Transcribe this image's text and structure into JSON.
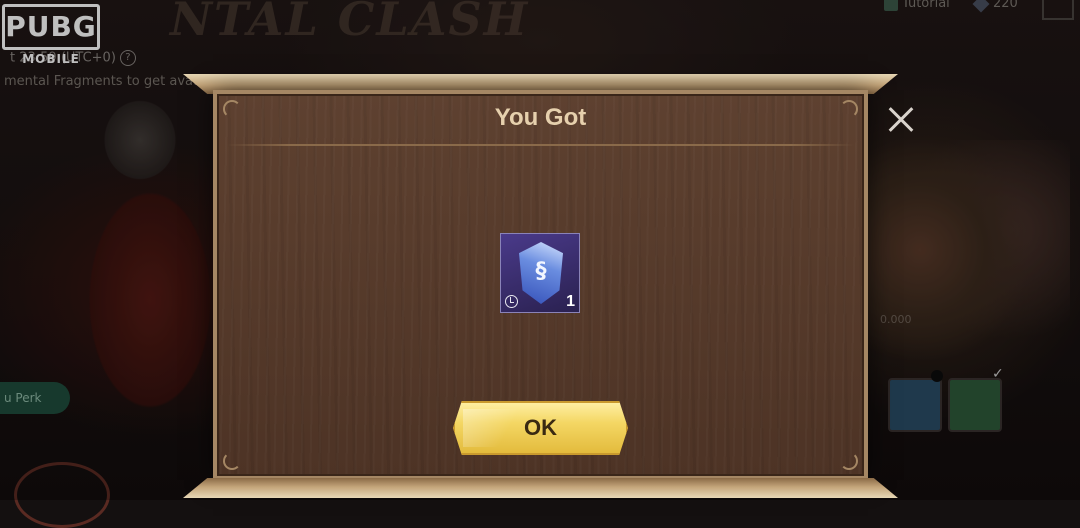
{
  "brand": {
    "logo_main": "PUBG",
    "logo_sub": "MOBILE"
  },
  "background": {
    "event_title": "NTAL CLASH",
    "timer_text": "t 23:59 (UTC+0)",
    "description_text": "mental Fragments to get avata",
    "tutorial_label": "Tutorial",
    "currency_amount": "220",
    "perk_label": "u Perk",
    "board_label": "0.000"
  },
  "modal": {
    "title": "You Got",
    "reward": {
      "icon": "dragon-crystal-icon",
      "quantity": "1",
      "is_time_limited": true
    },
    "ok_label": "OK"
  },
  "colors": {
    "title_text": "#e6d0ad",
    "frame_gold": "#a58764",
    "panel_wood": "#5e4130",
    "ok_button": "#f4d764",
    "reward_bg": "#4a3a8a"
  }
}
